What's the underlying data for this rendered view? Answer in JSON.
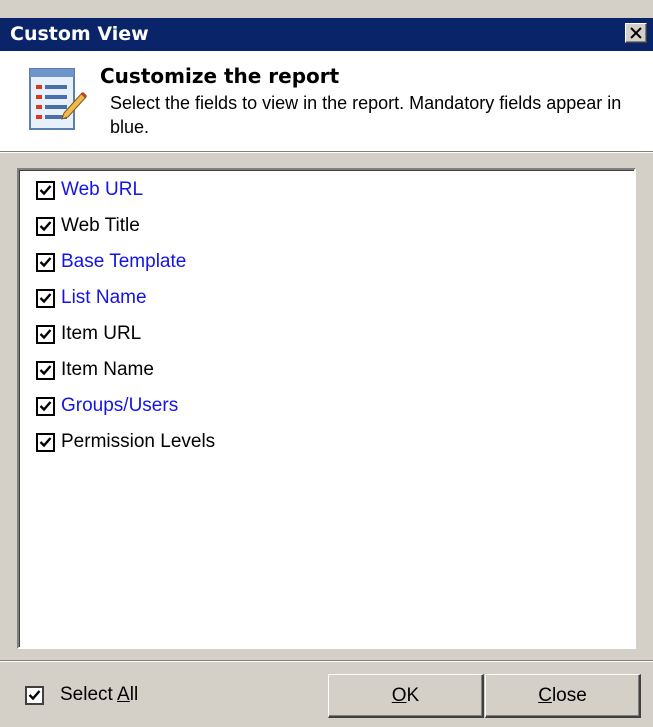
{
  "window": {
    "title": "Custom View",
    "colors": {
      "titlebar": "#0a246a",
      "mandatory": "#1414e6",
      "optional": "#000000"
    }
  },
  "header": {
    "title": "Customize the report",
    "description": "Select the fields to view in the report. Mandatory fields appear in blue.",
    "icon": "report-list-icon"
  },
  "fields": [
    {
      "label": "Web URL",
      "checked": true,
      "mandatory": true
    },
    {
      "label": "Web Title",
      "checked": true,
      "mandatory": false
    },
    {
      "label": "Base Template",
      "checked": true,
      "mandatory": true
    },
    {
      "label": "List Name",
      "checked": true,
      "mandatory": true
    },
    {
      "label": "Item URL",
      "checked": true,
      "mandatory": false
    },
    {
      "label": "Item Name",
      "checked": true,
      "mandatory": false
    },
    {
      "label": "Groups/Users",
      "checked": true,
      "mandatory": true
    },
    {
      "label": "Permission Levels",
      "checked": true,
      "mandatory": false
    }
  ],
  "footer": {
    "select_all": {
      "prefix": "Select ",
      "accel": "A",
      "suffix": "ll",
      "checked": true
    },
    "ok_button": {
      "accel": "O",
      "rest": "K"
    },
    "close_button": {
      "accel": "C",
      "rest": "lose"
    }
  }
}
